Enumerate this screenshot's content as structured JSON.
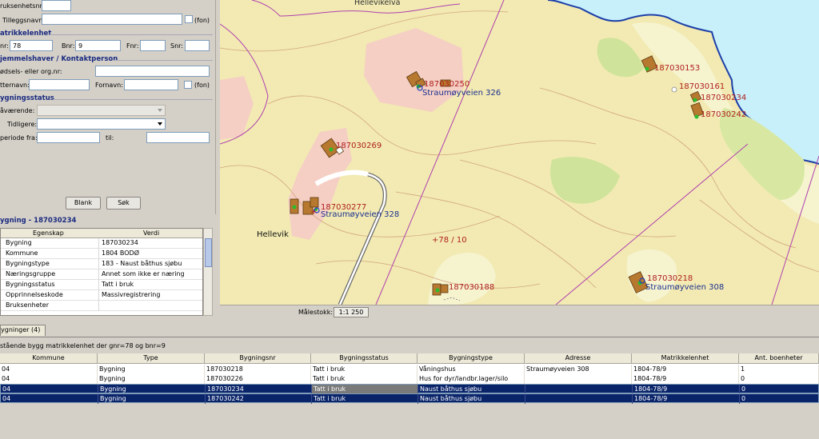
{
  "search": {
    "bruksenhet_label": "ruksenhetsnr:",
    "tilleggsnavn_label": "Tilleggsnavn:",
    "fon1": "(fon)",
    "matrikkel_section": "atrikkelenhet",
    "gnr_label": "nr:",
    "gnr_value": "78",
    "bnr_label": "Bnr:",
    "bnr_value": "9",
    "fnr_label": "Fnr:",
    "snr_label": "Snr:",
    "hjemmel_section": "jemmelshaver / Kontaktperson",
    "fodsel_label": "ødsels- eller org.nr:",
    "etternavn_label": "tternavn:",
    "fornavn_label": "Fornavn:",
    "fon2": "(fon)",
    "status_section": "ygningsstatus",
    "navarende_label": "åværende:",
    "tidligere_label": "Tidligere:",
    "periode_label": "periode fra:",
    "til_label": "til:",
    "blank_button": "Blank",
    "sok_button": "Søk"
  },
  "props": {
    "title": "ygning - 187030234",
    "col_egenskap": "Egenskap",
    "col_verdi": "Verdi",
    "rows": [
      {
        "k": "Bygning",
        "v": "187030234"
      },
      {
        "k": "Kommune",
        "v": "1804  BODØ"
      },
      {
        "k": "Bygningstype",
        "v": "183 - Naust båthus sjøbu"
      },
      {
        "k": "Næringsgruppe",
        "v": "Annet som ikke er næring"
      },
      {
        "k": "Bygningsstatus",
        "v": "Tatt i bruk"
      },
      {
        "k": "Opprinnelseskode",
        "v": "Massivregistrering"
      },
      {
        "k": "Bruksenheter",
        "v": ""
      }
    ]
  },
  "map": {
    "labels": [
      {
        "id": "hellevikelva",
        "text": "Hellevikelva"
      },
      {
        "id": "b153",
        "text": "187030153"
      },
      {
        "id": "b161",
        "text": "187030161"
      },
      {
        "id": "b234",
        "text": "187030234"
      },
      {
        "id": "b242",
        "text": "187030242"
      },
      {
        "id": "b250",
        "text": "187030250"
      },
      {
        "id": "a326",
        "text": "Straumøyveien 326"
      },
      {
        "id": "b269",
        "text": "187030269"
      },
      {
        "id": "b277",
        "text": "187030277"
      },
      {
        "id": "a328",
        "text": "Straumøyveien 328"
      },
      {
        "id": "hellevik",
        "text": "Hellevik"
      },
      {
        "id": "parcel",
        "text": "+78 / 10"
      },
      {
        "id": "b188",
        "text": "187030188"
      },
      {
        "id": "b218",
        "text": "187030218"
      },
      {
        "id": "a308",
        "text": "Straumøyveien 308"
      }
    ],
    "scale_label": "Målestokk:",
    "scale_value": "1:1 250",
    "colors": {
      "land": "#f2eab2",
      "water": "#c8f0fb",
      "building": "#b7782f",
      "green": "#cfe39a",
      "plot": "#f5cfc4"
    }
  },
  "bottom": {
    "tab_label": "ygninger (4)",
    "filter_text": "stående bygg matrikkelenhet der gnr=78 og  bnr=9",
    "columns": [
      "Kommune",
      "Type",
      "Bygningsnr",
      "Bygningsstatus",
      "Bygningstype",
      "Adresse",
      "Matrikkelenhet",
      "Ant. boenheter"
    ],
    "rows": [
      [
        "04",
        "Bygning",
        "187030218",
        "Tatt i bruk",
        "Våningshus",
        "Straumøyveien 308",
        "1804-78/9",
        "1"
      ],
      [
        "04",
        "Bygning",
        "187030226",
        "Tatt i bruk",
        "Hus for dyr/landbr.lager/silo",
        "",
        "1804-78/9",
        "0"
      ],
      [
        "04",
        "Bygning",
        "187030234",
        "Tatt i bruk",
        "Naust båthus sjøbu",
        "",
        "1804-78/9",
        "0"
      ],
      [
        "04",
        "Bygning",
        "187030242",
        "Tatt i bruk",
        "Naust båthus sjøbu",
        "",
        "1804-78/9",
        "0"
      ]
    ]
  }
}
